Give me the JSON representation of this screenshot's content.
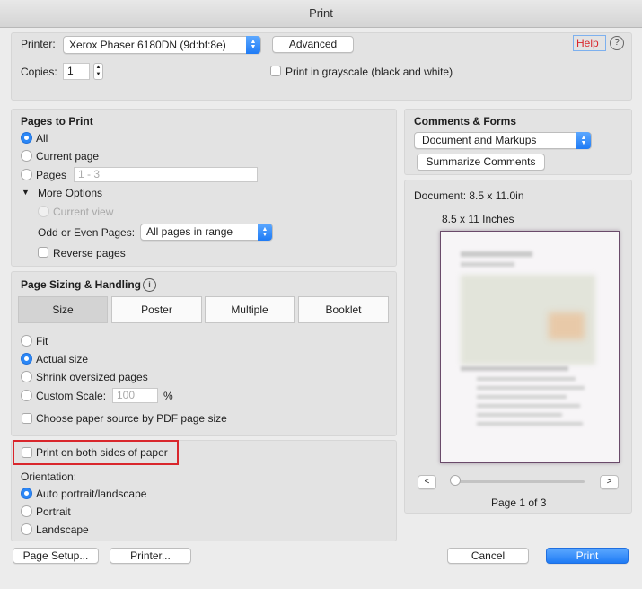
{
  "window": {
    "title": "Print"
  },
  "printer": {
    "label": "Printer:",
    "value": "Xerox Phaser 6180DN (9d:bf:8e)",
    "advanced": "Advanced",
    "help": "Help",
    "help_q": "?"
  },
  "copies": {
    "label": "Copies:",
    "value": "1",
    "grayscale": "Print in grayscale (black and white)"
  },
  "pages": {
    "heading": "Pages to Print",
    "all": "All",
    "current": "Current page",
    "pages": "Pages",
    "pages_placeholder": "1 - 3",
    "more": "More Options",
    "current_view": "Current view",
    "odd_even_label": "Odd or Even Pages:",
    "odd_even_value": "All pages in range",
    "reverse": "Reverse pages"
  },
  "sizing": {
    "heading": "Page Sizing & Handling",
    "info_icon": "i",
    "tabs": [
      "Size",
      "Poster",
      "Multiple",
      "Booklet"
    ],
    "fit": "Fit",
    "actual": "Actual size",
    "shrink": "Shrink oversized pages",
    "custom": "Custom Scale:",
    "custom_placeholder": "100",
    "percent": "%",
    "paper_source": "Choose paper source by PDF page size"
  },
  "duplex": {
    "label": "Print on both sides of paper"
  },
  "orientation": {
    "heading": "Orientation:",
    "auto": "Auto portrait/landscape",
    "portrait": "Portrait",
    "landscape": "Landscape"
  },
  "comments": {
    "heading": "Comments & Forms",
    "value": "Document and Markups",
    "summarize": "Summarize Comments"
  },
  "preview": {
    "document": "Document: 8.5 x 11.0in",
    "size": "8.5 x 11 Inches",
    "prev": "<",
    "next": ">",
    "page": "Page 1 of 3"
  },
  "footer": {
    "page_setup": "Page Setup...",
    "printer": "Printer...",
    "cancel": "Cancel",
    "print": "Print"
  },
  "colors": {
    "accent": "#2b87f6",
    "highlight_box": "#d9262c"
  }
}
